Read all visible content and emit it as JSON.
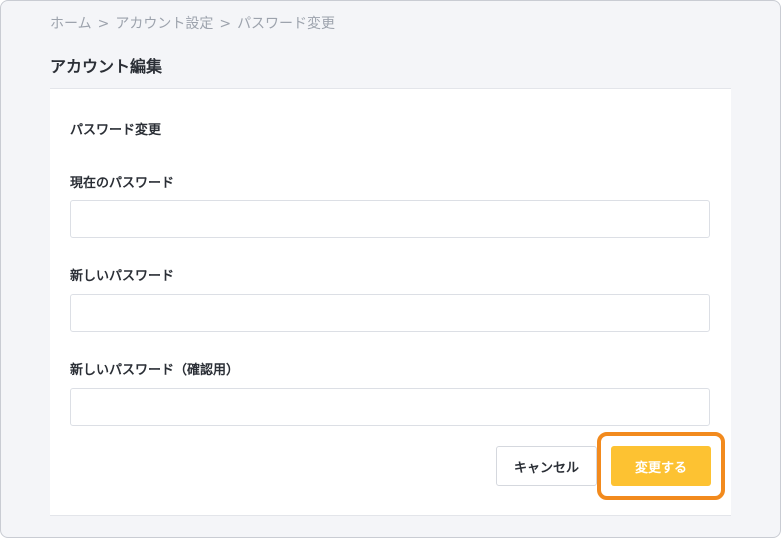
{
  "breadcrumb": {
    "items": [
      "ホーム",
      "アカウント設定",
      "パスワード変更"
    ],
    "separator": ">"
  },
  "page": {
    "title": "アカウント編集"
  },
  "form": {
    "section_title": "パスワード変更",
    "current_password": {
      "label": "現在のパスワード",
      "value": "",
      "placeholder": ""
    },
    "new_password": {
      "label": "新しいパスワード",
      "value": "",
      "placeholder": ""
    },
    "confirm_password": {
      "label": "新しいパスワード（確認用）",
      "value": "",
      "placeholder": ""
    }
  },
  "actions": {
    "cancel_label": "キャンセル",
    "submit_label": "変更する"
  },
  "colors": {
    "accent": "#fdc232",
    "highlight": "#f28a1d",
    "background": "#f4f5f8"
  }
}
